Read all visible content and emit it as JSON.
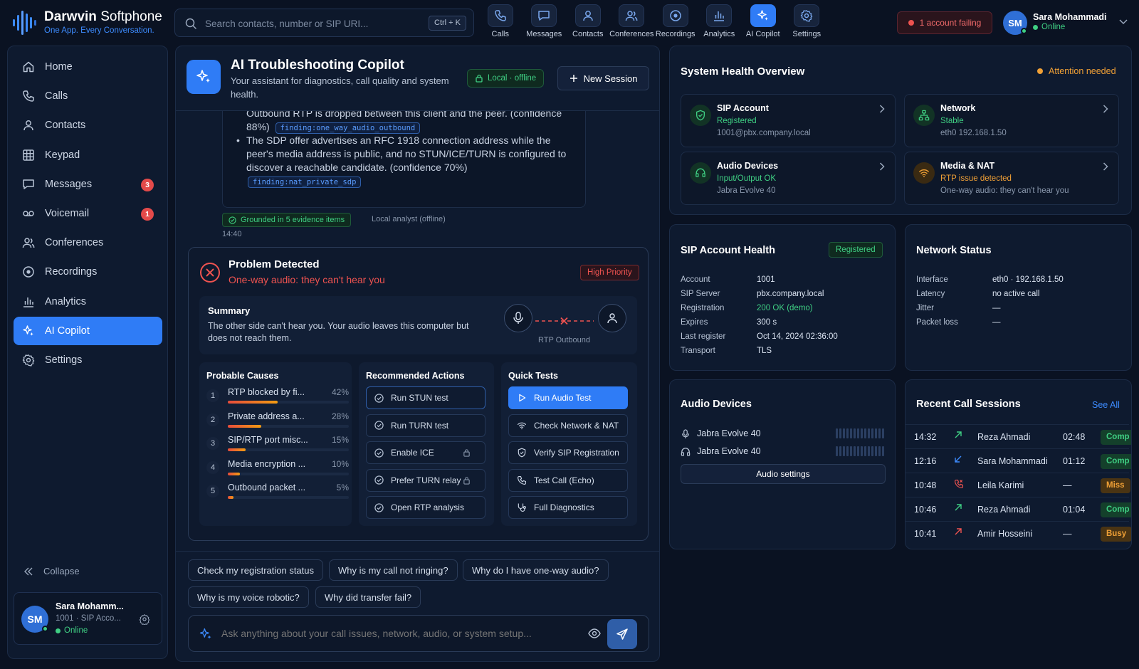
{
  "app": {
    "name_bold": "Darwvin",
    "name_rest": " Softphone",
    "tagline": "One App. Every Conversation."
  },
  "search": {
    "placeholder": "Search contacts, number or SIP URI...",
    "shortcut": "Ctrl + K"
  },
  "topnav": [
    {
      "label": "Calls",
      "icon": "phone-icon"
    },
    {
      "label": "Messages",
      "icon": "chat-icon"
    },
    {
      "label": "Contacts",
      "icon": "user-icon"
    },
    {
      "label": "Conferences",
      "icon": "users-icon"
    },
    {
      "label": "Recordings",
      "icon": "record-icon"
    },
    {
      "label": "Analytics",
      "icon": "bar-chart-icon"
    },
    {
      "label": "AI Copilot",
      "icon": "sparkle-icon",
      "active": true
    },
    {
      "label": "Settings",
      "icon": "gear-icon"
    }
  ],
  "alert": {
    "text": "1 account failing"
  },
  "user": {
    "initials": "SM",
    "name": "Sara Mohammadi",
    "short_name": "Sara Mohamm...",
    "status": "Online",
    "account": "1001 · SIP Acco..."
  },
  "sidebar": {
    "items": [
      {
        "label": "Home",
        "icon": "home-icon"
      },
      {
        "label": "Calls",
        "icon": "phone-icon"
      },
      {
        "label": "Contacts",
        "icon": "user-icon"
      },
      {
        "label": "Keypad",
        "icon": "keypad-icon"
      },
      {
        "label": "Messages",
        "icon": "chat-icon",
        "badge": "3"
      },
      {
        "label": "Voicemail",
        "icon": "voicemail-icon",
        "badge": "1"
      },
      {
        "label": "Conferences",
        "icon": "users-icon"
      },
      {
        "label": "Recordings",
        "icon": "record-icon"
      },
      {
        "label": "Analytics",
        "icon": "bar-chart-icon"
      },
      {
        "label": "AI Copilot",
        "icon": "sparkle-icon",
        "active": true
      },
      {
        "label": "Settings",
        "icon": "gear-icon"
      }
    ],
    "collapse": "Collapse"
  },
  "copilot": {
    "title": "AI Troubleshooting Copilot",
    "subtitle1": "Your assistant for diagnostics, call quality and system",
    "subtitle2": "health.",
    "mode": "Local · offline",
    "new_session": "New Session",
    "message": {
      "cut_line": "Outbound RTP is dropped between this client and the peer. (confidence",
      "line_a1": "Outbound RTP is dropped between this client and the peer. (confidence",
      "line_a2": "88%)",
      "tag_a": "finding:one_way_audio_outbound",
      "line_b1": "The SDP offer advertises an RFC 1918 connection address while the",
      "line_b2": "peer's media address is public, and no STUN/ICE/TURN is configured to",
      "line_b3": "discover a reachable candidate. (confidence 70%)",
      "tag_b": "finding:nat_private_sdp",
      "grounded": "Grounded in 5 evidence items",
      "analyst": "Local analyst (offline)",
      "time": "14:40"
    },
    "problem": {
      "title": "Problem Detected",
      "subtitle": "One-way audio: they can't hear you",
      "priority": "High Priority",
      "summary_title": "Summary",
      "summary_1": "The other side can't hear you. Your audio leaves this computer but",
      "summary_2": "does not reach them.",
      "rtp_label": "RTP Outbound",
      "causes_title": "Probable Causes",
      "causes": [
        {
          "n": "1",
          "label": "RTP blocked by fi...",
          "pct": "42%",
          "value": 0.42
        },
        {
          "n": "2",
          "label": "Private address a...",
          "pct": "28%",
          "value": 0.28
        },
        {
          "n": "3",
          "label": "SIP/RTP port misc...",
          "pct": "15%",
          "value": 0.15
        },
        {
          "n": "4",
          "label": "Media encryption ...",
          "pct": "10%",
          "value": 0.1
        },
        {
          "n": "5",
          "label": "Outbound packet ...",
          "pct": "5%",
          "value": 0.05
        }
      ],
      "actions_title": "Recommended Actions",
      "actions": [
        {
          "label": "Run STUN test"
        },
        {
          "label": "Run TURN test"
        },
        {
          "label": "Enable ICE",
          "locked": true
        },
        {
          "label": "Prefer TURN relay",
          "locked": true
        },
        {
          "label": "Open RTP analysis"
        }
      ],
      "tests_title": "Quick Tests",
      "tests": [
        {
          "label": "Run Audio Test",
          "icon": "play-icon"
        },
        {
          "label": "Check Network & NAT",
          "icon": "wifi-icon"
        },
        {
          "label": "Verify SIP Registration",
          "icon": "shield-icon"
        },
        {
          "label": "Test Call (Echo)",
          "icon": "phone-icon"
        },
        {
          "label": "Full Diagnostics",
          "icon": "stethoscope-icon"
        }
      ]
    },
    "suggestions": [
      "Check my registration status",
      "Why is my call not ringing?",
      "Why do I have one-way audio?",
      "Why is my voice robotic?",
      "Why did transfer fail?"
    ],
    "input_placeholder": "Ask anything about your call issues, network, audio, or system setup..."
  },
  "health": {
    "title": "System Health Overview",
    "status": "Attention needed",
    "cards": [
      {
        "title": "SIP Account",
        "status": "Registered",
        "detail": "1001@pbx.company.local",
        "tone": "green",
        "icon": "shield-check-icon"
      },
      {
        "title": "Network",
        "status": "Stable",
        "detail": "eth0 192.168.1.50",
        "tone": "green",
        "icon": "network-icon"
      },
      {
        "title": "Audio Devices",
        "status": "Input/Output OK",
        "detail": "Jabra Evolve 40",
        "tone": "green",
        "icon": "headset-icon"
      },
      {
        "title": "Media & NAT",
        "status": "RTP issue detected",
        "detail": "One-way audio: they can't hear you",
        "tone": "orange",
        "icon": "wifi-icon"
      }
    ]
  },
  "sip_health": {
    "title": "SIP Account Health",
    "badge": "Registered",
    "rows": [
      {
        "k": "Account",
        "v": "1001"
      },
      {
        "k": "SIP Server",
        "v": "pbx.company.local"
      },
      {
        "k": "Registration",
        "v": "200 OK (demo)"
      },
      {
        "k": "Expires",
        "v": "300 s"
      },
      {
        "k": "Last register",
        "v": "Oct 14, 2024 02:36:00"
      },
      {
        "k": "Transport",
        "v": "TLS"
      }
    ]
  },
  "network": {
    "title": "Network Status",
    "rows": [
      {
        "k": "Interface",
        "v": "eth0 · 192.168.1.50"
      },
      {
        "k": "Latency",
        "v": "no active call"
      },
      {
        "k": "Jitter",
        "v": "—"
      },
      {
        "k": "Packet loss",
        "v": "—"
      }
    ]
  },
  "audio": {
    "title": "Audio Devices",
    "input": "Jabra Evolve 40",
    "output": "Jabra Evolve 40",
    "settings": "Audio settings"
  },
  "recent": {
    "title": "Recent Call Sessions",
    "see_all": "See All",
    "rows": [
      {
        "time": "14:32",
        "dir": "outgoing",
        "name": "Reza Ahmadi",
        "dur": "02:48",
        "status": "Comp",
        "tone": "green"
      },
      {
        "time": "12:16",
        "dir": "incoming",
        "name": "Sara Mohammadi",
        "dur": "01:12",
        "status": "Comp",
        "tone": "green"
      },
      {
        "time": "10:48",
        "dir": "missed",
        "name": "Leila Karimi",
        "dur": "—",
        "status": "Miss",
        "tone": "orange"
      },
      {
        "time": "10:46",
        "dir": "outgoing",
        "name": "Reza Ahmadi",
        "dur": "01:04",
        "status": "Comp",
        "tone": "green"
      },
      {
        "time": "10:41",
        "dir": "outgoing-red",
        "name": "Amir Hosseini",
        "dur": "—",
        "status": "Busy",
        "tone": "orange"
      }
    ]
  }
}
